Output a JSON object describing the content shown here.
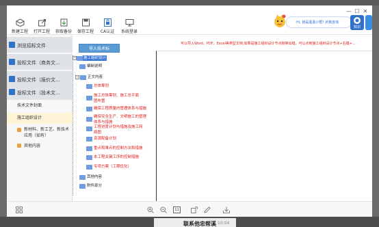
{
  "window": {
    "minimize": "—",
    "maximize": "☐",
    "close": "✕"
  },
  "toolbar": [
    {
      "label": "新建工程",
      "icon": "new-project-icon"
    },
    {
      "label": "打开工程",
      "icon": "open-project-icon"
    },
    {
      "label": "获取备份",
      "icon": "backup-icon"
    },
    {
      "label": "保存工程",
      "icon": "save-icon"
    },
    {
      "label": "CA认证",
      "icon": "ca-lock-icon"
    },
    {
      "label": "系统登录",
      "icon": "login-icon"
    }
  ],
  "user": {
    "text": "Hi, 我是嘉嘉小帮! 点我咨询"
  },
  "side_buttons": [
    {
      "label": "知识",
      "color": "#2f72c8"
    },
    {
      "label": "",
      "color": "#3b8de0"
    }
  ],
  "sidebar": {
    "items": [
      {
        "label": "浏览招标文件"
      },
      {
        "label": "投标文件（商务文..."
      },
      {
        "label": "投标文件（报价文..."
      },
      {
        "label": "投标文件（技术文..."
      }
    ],
    "sub_items": [
      {
        "label": "技术文件封面"
      },
      {
        "label": "施工组织设计"
      },
      {
        "label": "新材料、新工艺、新技术应用（如有）"
      },
      {
        "label": "其他内容"
      }
    ]
  },
  "hint": "可以导入Word、PDF、Excel等类型文档;如果是施工组织设计节点转换出错，可以点到施工组织设计节点+右键+...",
  "import_button": "导入技术标",
  "tree": [
    {
      "label": "施工组织设计",
      "style": "sel"
    },
    {
      "label": "编制说明",
      "style": "blk"
    },
    {
      "label": "正文内容",
      "style": "blk"
    },
    {
      "label": "总体筹划",
      "style": "red"
    },
    {
      "label": "施工总体筹划、施工总平面图布置",
      "style": "red"
    },
    {
      "label": "确保工程质量的管理体系与措施",
      "style": "red"
    },
    {
      "label": "确保安全生产、文明施工的管理体系与措施",
      "style": "red"
    },
    {
      "label": "工程进度计划与措施及施工网络图",
      "style": "red"
    },
    {
      "label": "资源配备计划",
      "style": "red"
    },
    {
      "label": "重点和难点的控制方法和措施",
      "style": "red"
    },
    {
      "label": "本工程关键工序的控制措施",
      "style": "red"
    },
    {
      "label": "专项方案（工期优化）",
      "style": "red"
    },
    {
      "label": "其他内容",
      "style": "blk"
    },
    {
      "label": "附件部分",
      "style": "blk"
    }
  ],
  "bottom_icons": [
    "grid-icon",
    "zoom-in-icon",
    "zoom-out-icon",
    "fit-page-icon",
    "rotate-icon",
    "edit-icon",
    "download-icon"
  ],
  "bottom_counter": "11",
  "background": {
    "notification": "联系他忠帮溪",
    "time": "10:04"
  }
}
